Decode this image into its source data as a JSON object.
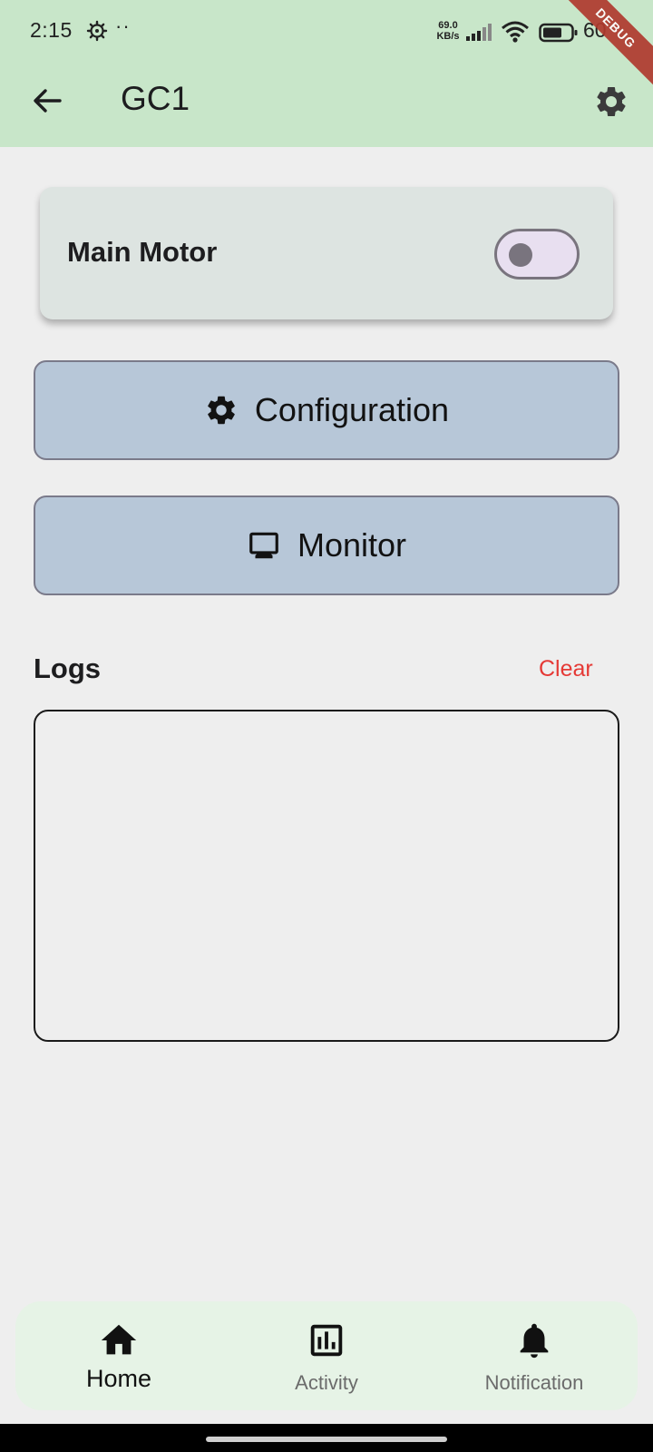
{
  "status_bar": {
    "time": "2:15",
    "dots": "··",
    "net_speed_value": "69.0",
    "net_speed_unit": "KB/s",
    "battery_percent": "60",
    "icons": [
      "settings-gear-icon",
      "signal-icon",
      "wifi-icon",
      "battery-icon"
    ]
  },
  "debug_banner": "DEBUG",
  "app_bar": {
    "title": "GC1",
    "back_icon": "arrow-left-icon",
    "settings_icon": "settings-icon"
  },
  "motor_card": {
    "label": "Main Motor",
    "switch_on": false
  },
  "buttons": {
    "configuration_label": "Configuration",
    "configuration_icon": "gear-icon",
    "monitor_label": "Monitor",
    "monitor_icon": "monitor-icon"
  },
  "logs": {
    "title": "Logs",
    "clear_label": "Clear",
    "entries": []
  },
  "bottom_nav": {
    "selected": "Home",
    "items": [
      {
        "label": "Home",
        "icon": "home-icon"
      },
      {
        "label": "Activity",
        "icon": "activity-chart-icon"
      },
      {
        "label": "Notification",
        "icon": "bell-icon"
      }
    ]
  },
  "colors": {
    "app_bar": "#c8e6c9",
    "background": "#eeeeee",
    "card": "#dde4e1",
    "button": "#b7c7d8",
    "clear_text": "#e53935",
    "bottom_nav": "#e6f3e6",
    "debug_banner": "#b03a2e"
  }
}
